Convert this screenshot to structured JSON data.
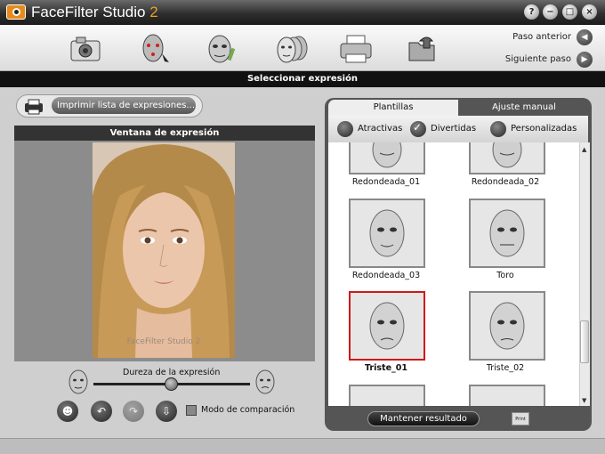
{
  "app": {
    "name": "FaceFilter Studio",
    "version": "2",
    "window_buttons": [
      "?",
      "−",
      "□",
      "×"
    ]
  },
  "toolbar": {
    "tools": [
      "camera-icon",
      "face-points-icon",
      "face-edit-icon",
      "expression-faces-icon",
      "printer-icon",
      "export-folder-icon"
    ],
    "prev_label": "Paso anterior",
    "next_label": "Siguiente paso"
  },
  "section_title": "Seleccionar expresión",
  "left": {
    "print_button": "Imprimir lista de expresiones...",
    "window_title": "Ventana de expresión",
    "watermark": "FaceFilter Studio 2",
    "hardness_label": "Dureza de la expresión",
    "hardness_value": 0.5,
    "compare_label": "Modo de comparación",
    "compare_checked": false
  },
  "right": {
    "tabs": [
      "Plantillas",
      "Ajuste manual"
    ],
    "active_tab": 0,
    "filters": [
      "Atractivas",
      "Divertidas",
      "Personalizadas"
    ],
    "active_filter": 1,
    "templates": [
      {
        "label": "Redondeada_01",
        "selected": false
      },
      {
        "label": "Redondeada_02",
        "selected": false
      },
      {
        "label": "Redondeada_03",
        "selected": false
      },
      {
        "label": "Toro",
        "selected": false
      },
      {
        "label": "Triste_01",
        "selected": true
      },
      {
        "label": "Triste_02",
        "selected": false
      }
    ],
    "keep_button": "Mantener resultado",
    "print_small": "Print"
  },
  "colors": {
    "accent": "#f0a020",
    "selection": "#d01818"
  }
}
